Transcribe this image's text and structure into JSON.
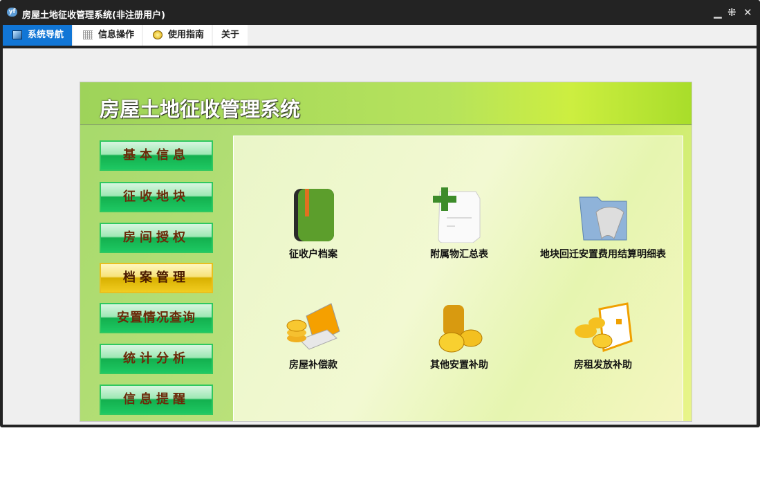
{
  "window": {
    "title": "房屋土地征收管理系统(非注册用户)",
    "logo": "yf",
    "controls": [
      "minimize-icon",
      "restore-icon",
      "close-icon"
    ]
  },
  "tabs": [
    {
      "label": "系统导航",
      "icon": "monitor-icon"
    },
    {
      "label": "信息操作",
      "icon": "grid-icon"
    },
    {
      "label": "使用指南",
      "icon": "help-icon"
    },
    {
      "label": "关于"
    }
  ],
  "header": {
    "title": "房屋土地征收管理系统"
  },
  "nav": [
    {
      "label": "基本信息"
    },
    {
      "label": "征收地块"
    },
    {
      "label": "房间授权"
    },
    {
      "label": "档案管理",
      "active": true
    },
    {
      "label": "安置情况查询"
    },
    {
      "label": "统计分析"
    },
    {
      "label": "信息提醒"
    }
  ],
  "items": [
    {
      "label": "征收户档案",
      "icon": "green-book-icon"
    },
    {
      "label": "附属物汇总表",
      "icon": "document-add-icon"
    },
    {
      "label": "地块回迁安置费用结算明细表",
      "icon": "folder-scroll-icon"
    },
    {
      "label": "房屋补偿款",
      "icon": "laptop-coins-icon"
    },
    {
      "label": "其他安置补助",
      "icon": "coins-icon"
    },
    {
      "label": "房租发放补助",
      "icon": "coins-document-icon"
    }
  ],
  "colors": {
    "active_tab": "#1176d6",
    "nav_green": "#1ec863",
    "nav_active": "#f1cc20"
  }
}
